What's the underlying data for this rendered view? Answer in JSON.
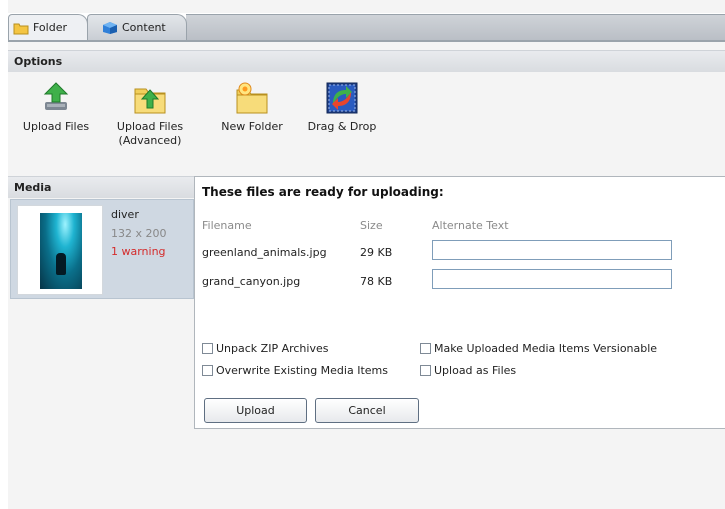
{
  "tabs": [
    {
      "label": "Folder",
      "icon": "folder-icon"
    },
    {
      "label": "Content",
      "icon": "cube-icon"
    }
  ],
  "options": {
    "title": "Options",
    "tools": [
      {
        "label_line1": "Upload Files",
        "label_line2": "",
        "icon": "upload-arrow-icon"
      },
      {
        "label_line1": "Upload Files",
        "label_line2": "(Advanced)",
        "icon": "upload-folder-icon"
      },
      {
        "label_line1": "New Folder",
        "label_line2": "",
        "icon": "new-folder-icon"
      },
      {
        "label_line1": "Drag & Drop",
        "label_line2": "",
        "icon": "drag-drop-icon"
      }
    ]
  },
  "media": {
    "title": "Media",
    "item": {
      "name": "diver",
      "dimensions": "132 x 200",
      "warning": "1 warning"
    }
  },
  "dialog": {
    "title": "These files are ready for uploading:",
    "columns": {
      "filename": "Filename",
      "size": "Size",
      "alt": "Alternate Text"
    },
    "files": [
      {
        "filename": "greenland_animals.jpg",
        "size": "29 KB",
        "alt": ""
      },
      {
        "filename": "grand_canyon.jpg",
        "size": "78 KB",
        "alt": ""
      }
    ],
    "options": {
      "unpack_zip": "Unpack ZIP Archives",
      "overwrite": "Overwrite Existing Media Items",
      "versionable": "Make Uploaded Media Items Versionable",
      "as_files": "Upload as Files"
    },
    "upload_button": "Upload",
    "cancel_button": "Cancel"
  },
  "colors": {
    "warning": "#d42b2b",
    "selected_item": "#cfd8e2",
    "input_border": "#7f9db9"
  }
}
